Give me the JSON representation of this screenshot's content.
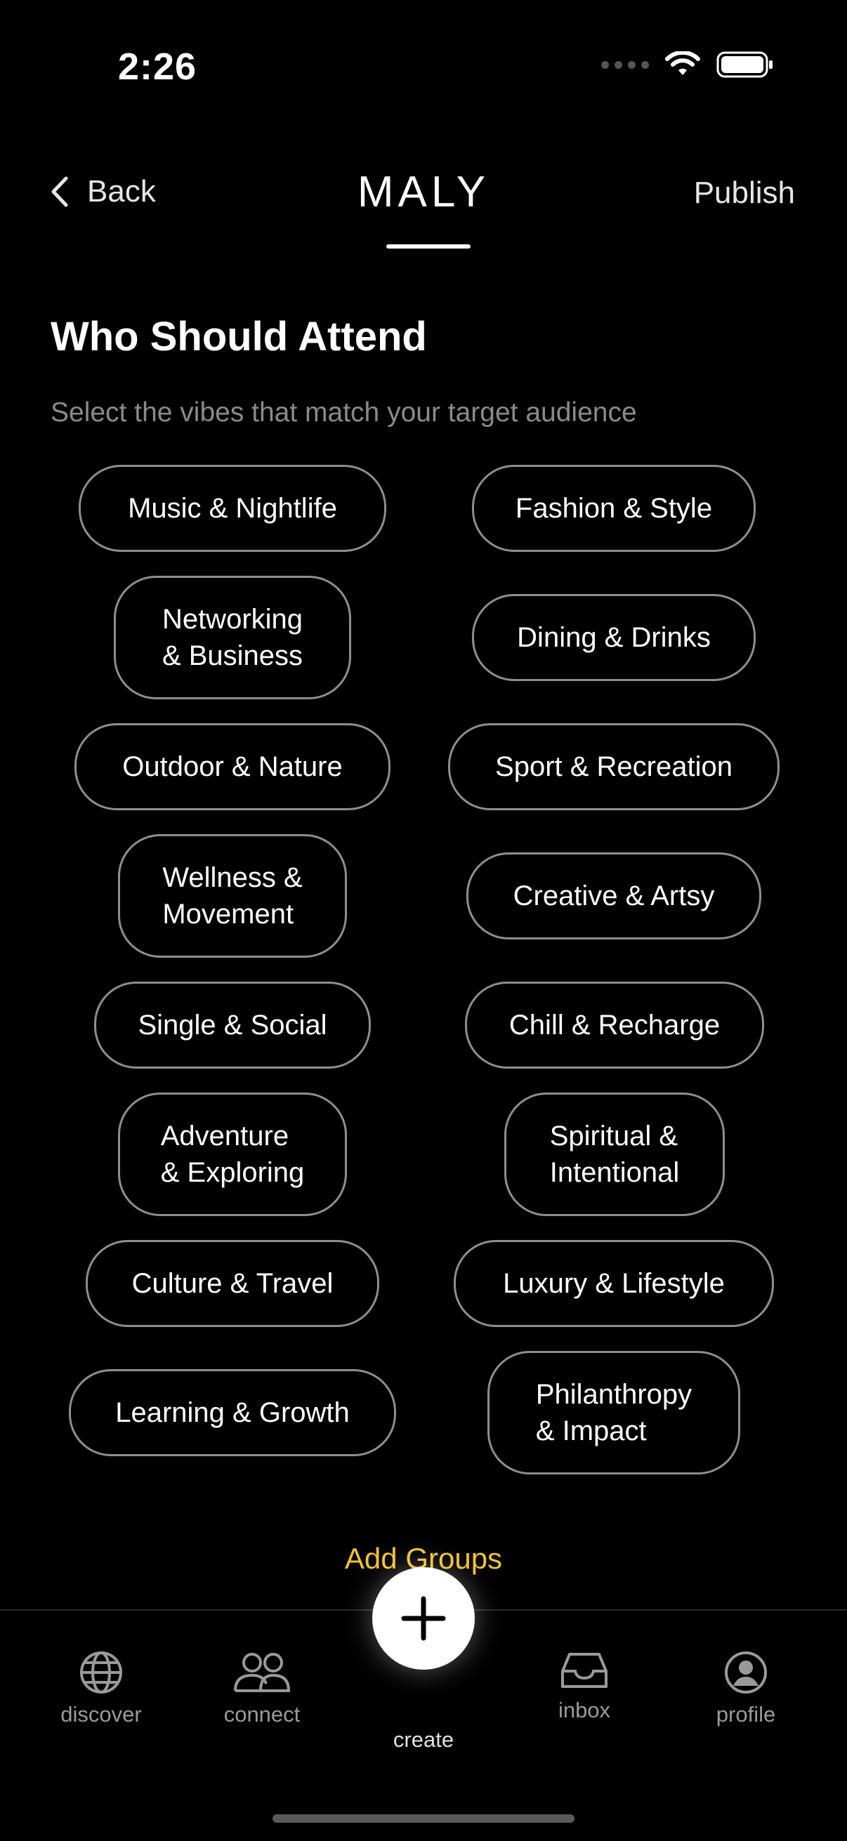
{
  "status_bar": {
    "time": "2:26"
  },
  "header": {
    "back_label": "Back",
    "title": "MALY",
    "publish_label": "Publish"
  },
  "section": {
    "heading": "Who Should Attend",
    "subtitle": "Select the vibes that match your target audience"
  },
  "vibes": [
    "Music & Nightlife",
    "Fashion & Style",
    "Networking\n& Business",
    "Dining & Drinks",
    "Outdoor & Nature",
    "Sport & Recreation",
    "Wellness &\nMovement",
    "Creative & Artsy",
    "Single & Social",
    "Chill & Recharge",
    "Adventure\n& Exploring",
    "Spiritual &\nIntentional",
    "Culture & Travel",
    "Luxury & Lifestyle",
    "Learning & Growth",
    "Philanthropy\n& Impact"
  ],
  "add_groups_label": "Add Groups",
  "tabs": {
    "discover": "discover",
    "connect": "connect",
    "create": "create",
    "inbox": "inbox",
    "profile": "profile"
  },
  "colors": {
    "accent": "#f2c230",
    "background": "#000000",
    "pill_border": "#8e8e8e"
  }
}
